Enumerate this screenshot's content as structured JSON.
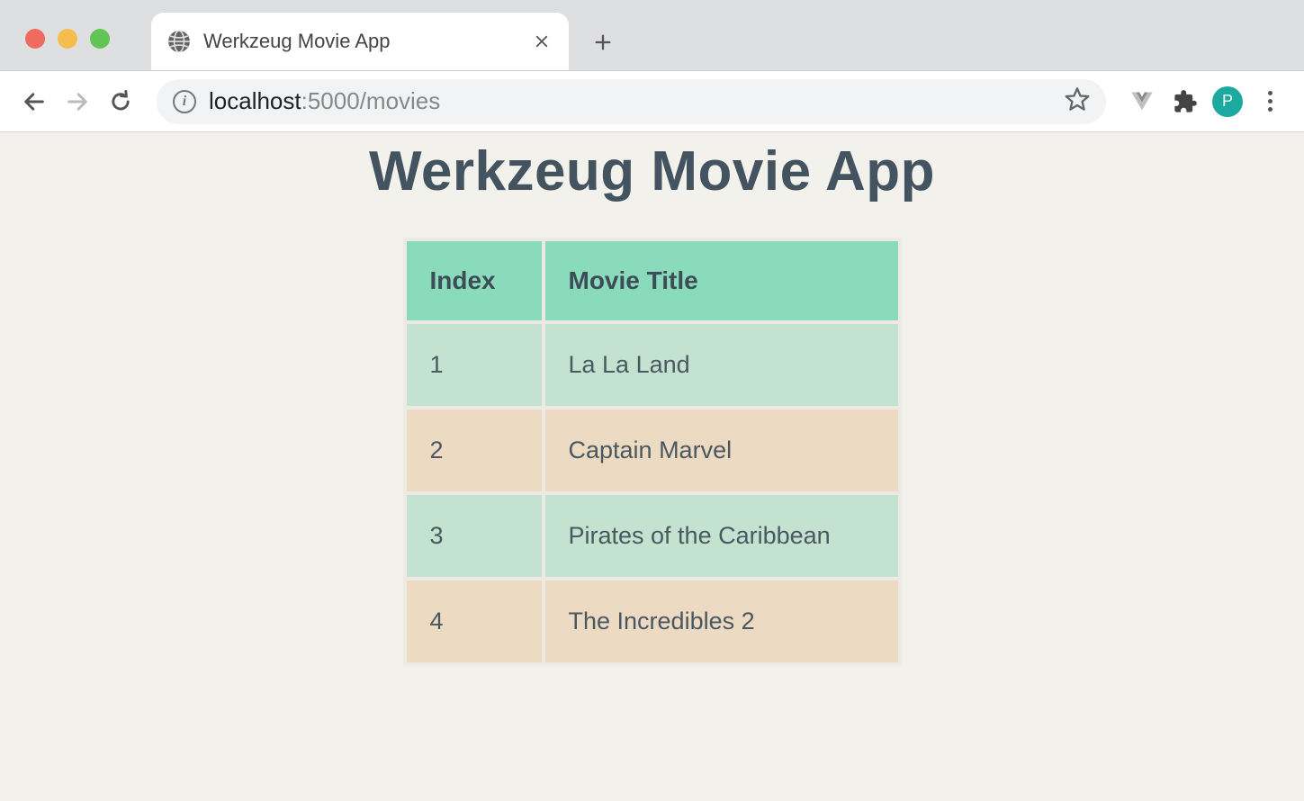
{
  "browser": {
    "tab_title": "Werkzeug Movie App",
    "url_host": "localhost",
    "url_path": ":5000/movies",
    "avatar_letter": "P"
  },
  "page": {
    "heading": "Werkzeug Movie App",
    "table": {
      "columns": [
        "Index",
        "Movie Title"
      ],
      "rows": [
        {
          "index": "1",
          "title": "La La Land"
        },
        {
          "index": "2",
          "title": "Captain Marvel"
        },
        {
          "index": "3",
          "title": "Pirates of the Caribbean"
        },
        {
          "index": "4",
          "title": "The Incredibles 2"
        }
      ]
    }
  }
}
